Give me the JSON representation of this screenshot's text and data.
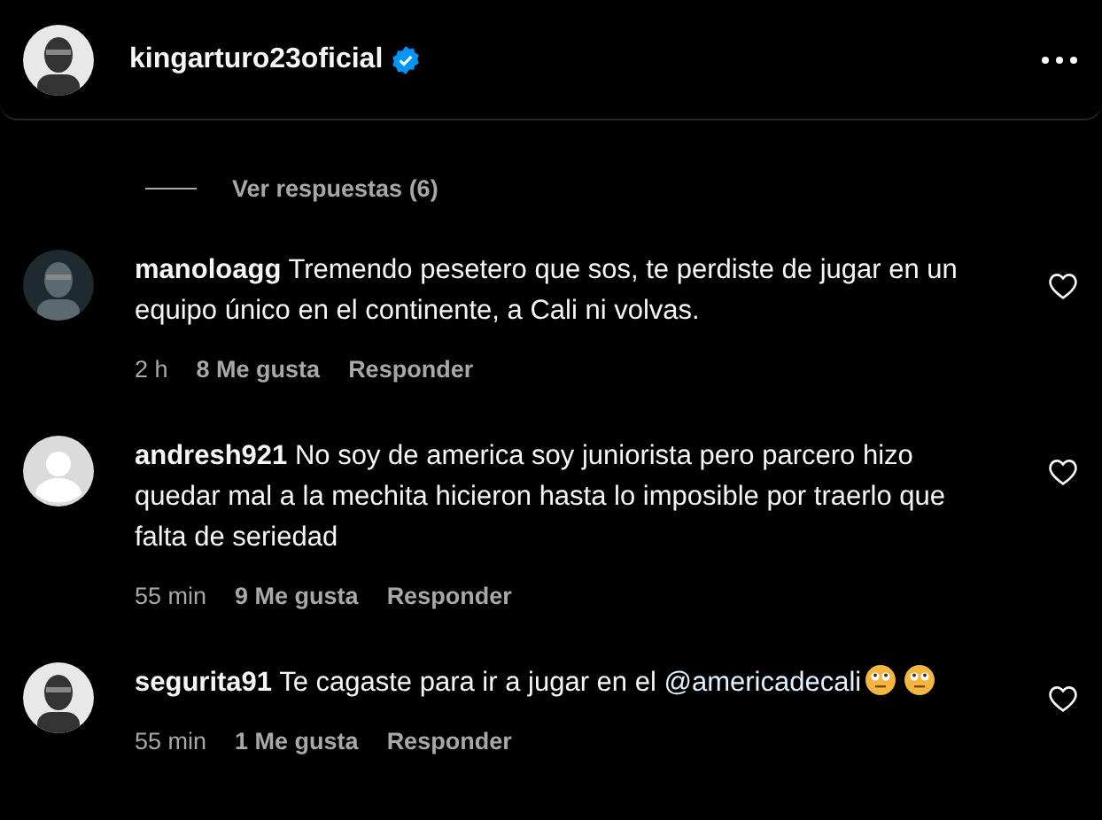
{
  "header": {
    "username": "kingarturo23oficial",
    "verified": true
  },
  "replies_toggle": {
    "label": "Ver respuestas (6)"
  },
  "comments": [
    {
      "username": "manoloagg",
      "body": [
        {
          "kind": "text",
          "text": "Tremendo pesetero que sos, te perdiste de jugar en un equipo único en el continente, a Cali ni volvas."
        }
      ],
      "time": "2 h",
      "likes": "8 Me gusta",
      "reply": "Responder",
      "liked": false
    },
    {
      "username": "andresh921",
      "avatar": {
        "kind": "placeholder"
      },
      "body": [
        {
          "kind": "text",
          "text": "No soy de america soy juniorista pero parcero hizo quedar mal a la mechita hicieron hasta lo imposible por traerlo que falta de seriedad"
        }
      ],
      "time": "55 min",
      "likes": "9 Me gusta",
      "reply": "Responder",
      "liked": false
    },
    {
      "username": "segurita91",
      "body": [
        {
          "kind": "text",
          "text": "Te cagaste para ir a jugar en el "
        },
        {
          "kind": "mention",
          "text": "@americadecali"
        },
        {
          "kind": "emoji"
        },
        {
          "kind": "emoji"
        }
      ],
      "time": "55 min",
      "likes": "1 Me gusta",
      "reply": "Responder",
      "liked": false
    }
  ]
}
